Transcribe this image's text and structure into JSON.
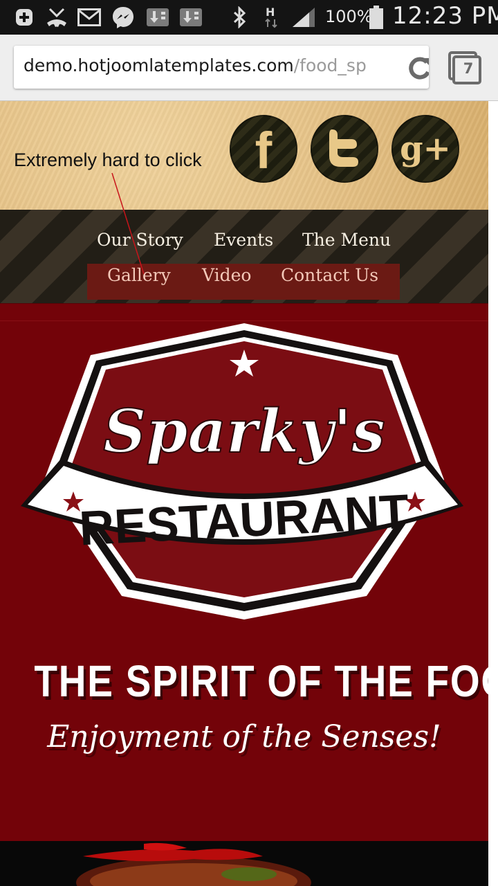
{
  "status_bar": {
    "battery_percent": "100%",
    "time": "12:23 PM",
    "icons": [
      "add-notification-icon",
      "missed-call-icon",
      "mail-icon",
      "messenger-icon",
      "download-icon",
      "download-icon",
      "bluetooth-icon",
      "h-plus-data-icon",
      "signal-icon",
      "battery-icon"
    ]
  },
  "browser": {
    "url_host": "demo.hotjoomlatemplates.com",
    "url_path": "/food_sp",
    "tab_count": "7",
    "icons": [
      "reload-icon",
      "tabs-icon"
    ]
  },
  "page": {
    "annotation": "Extremely hard to click",
    "social": [
      {
        "name": "facebook",
        "glyph": "f"
      },
      {
        "name": "twitter",
        "glyph": "t"
      },
      {
        "name": "google-plus",
        "glyph": "g+"
      }
    ],
    "nav_primary": [
      "Our Story",
      "Events",
      "The Menu"
    ],
    "nav_secondary": [
      "Gallery",
      "Video",
      "Contact Us"
    ],
    "logo": {
      "script": "Sparky's",
      "banner": "RESTAURANT"
    },
    "tagline": "THE SPIRIT OF THE FOOD",
    "subtagline": "Enjoyment of the Senses!",
    "colors": {
      "hero_red": "#730309",
      "nav_dark": "#2a241b",
      "parchment": "#e6c286",
      "social_glyph": "#e8c888"
    }
  }
}
